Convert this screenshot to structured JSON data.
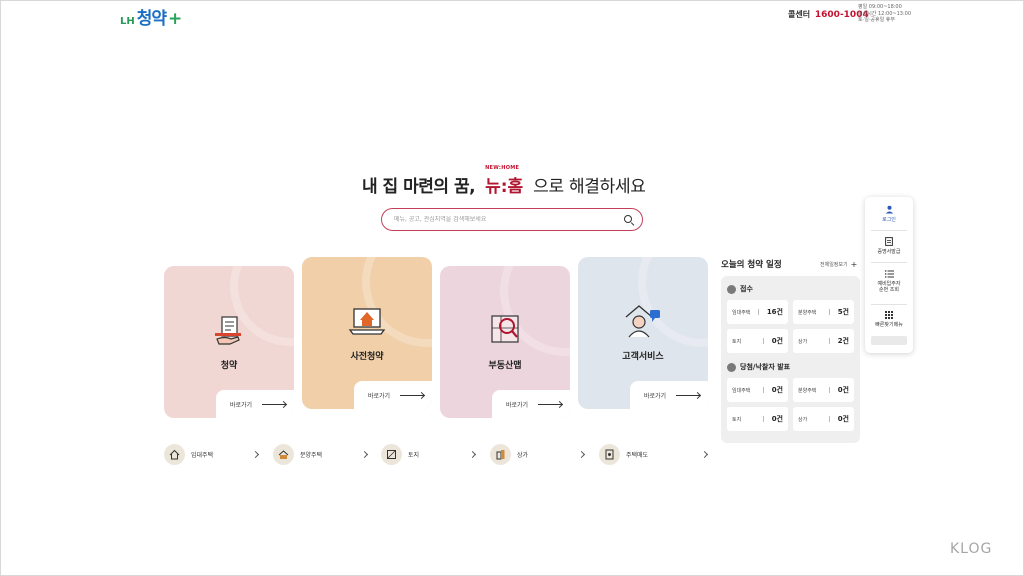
{
  "header": {
    "logo_lh": "LH",
    "logo_name": "청약",
    "logo_plus": "+",
    "callcenter_label": "콜센터",
    "callcenter_number": "1600-1004",
    "hours_line1": "평일 09:00~18:00",
    "hours_line2": "점심시간 12:00~13:00",
    "hours_line3": "토·일·공휴일 휴무"
  },
  "hero": {
    "pre": "내 집 마련의 꿈,",
    "brand_en": "NEW:HOME",
    "brand_kr": "뉴:홈",
    "post": "으로 해결하세요"
  },
  "search": {
    "placeholder": "메뉴, 공고, 관심지역을 검색해보세요"
  },
  "cards": [
    {
      "title": "청약",
      "go_label": "바로가기"
    },
    {
      "title": "사전청약",
      "go_label": "바로가기"
    },
    {
      "title": "부동산맵",
      "go_label": "바로가기"
    },
    {
      "title": "고객서비스",
      "go_label": "바로가기"
    }
  ],
  "quick_links": [
    {
      "label": "임대주택",
      "icon": "house-icon"
    },
    {
      "label": "분양주택",
      "icon": "house-key-icon"
    },
    {
      "label": "토지",
      "icon": "land-icon"
    },
    {
      "label": "상가",
      "icon": "building-icon"
    },
    {
      "label": "주택매도",
      "icon": "document-icon"
    }
  ],
  "schedule": {
    "title": "오늘의 청약 일정",
    "all_label": "전체일정보기",
    "sections": [
      {
        "title": "접수",
        "cells": [
          {
            "key": "임대주택",
            "value": "16건"
          },
          {
            "key": "분양주택",
            "value": "5건"
          },
          {
            "key": "토지",
            "value": "0건"
          },
          {
            "key": "상가",
            "value": "2건"
          }
        ]
      },
      {
        "title": "당첨/낙찰자 발표",
        "cells": [
          {
            "key": "임대주택",
            "value": "0건"
          },
          {
            "key": "분양주택",
            "value": "0건"
          },
          {
            "key": "토지",
            "value": "0건"
          },
          {
            "key": "상가",
            "value": "0건"
          }
        ]
      }
    ]
  },
  "side_menu": {
    "login": "로그인",
    "cert": "증명서발급",
    "waitlist_line1": "예비입주자",
    "waitlist_line2": "순번 조회",
    "all_menu": "빠른찾기메뉴"
  },
  "watermark": "KLOG",
  "colors": {
    "brand_red": "#c4122f",
    "logo_blue": "#1a6fc4",
    "logo_green": "#27a35a"
  }
}
